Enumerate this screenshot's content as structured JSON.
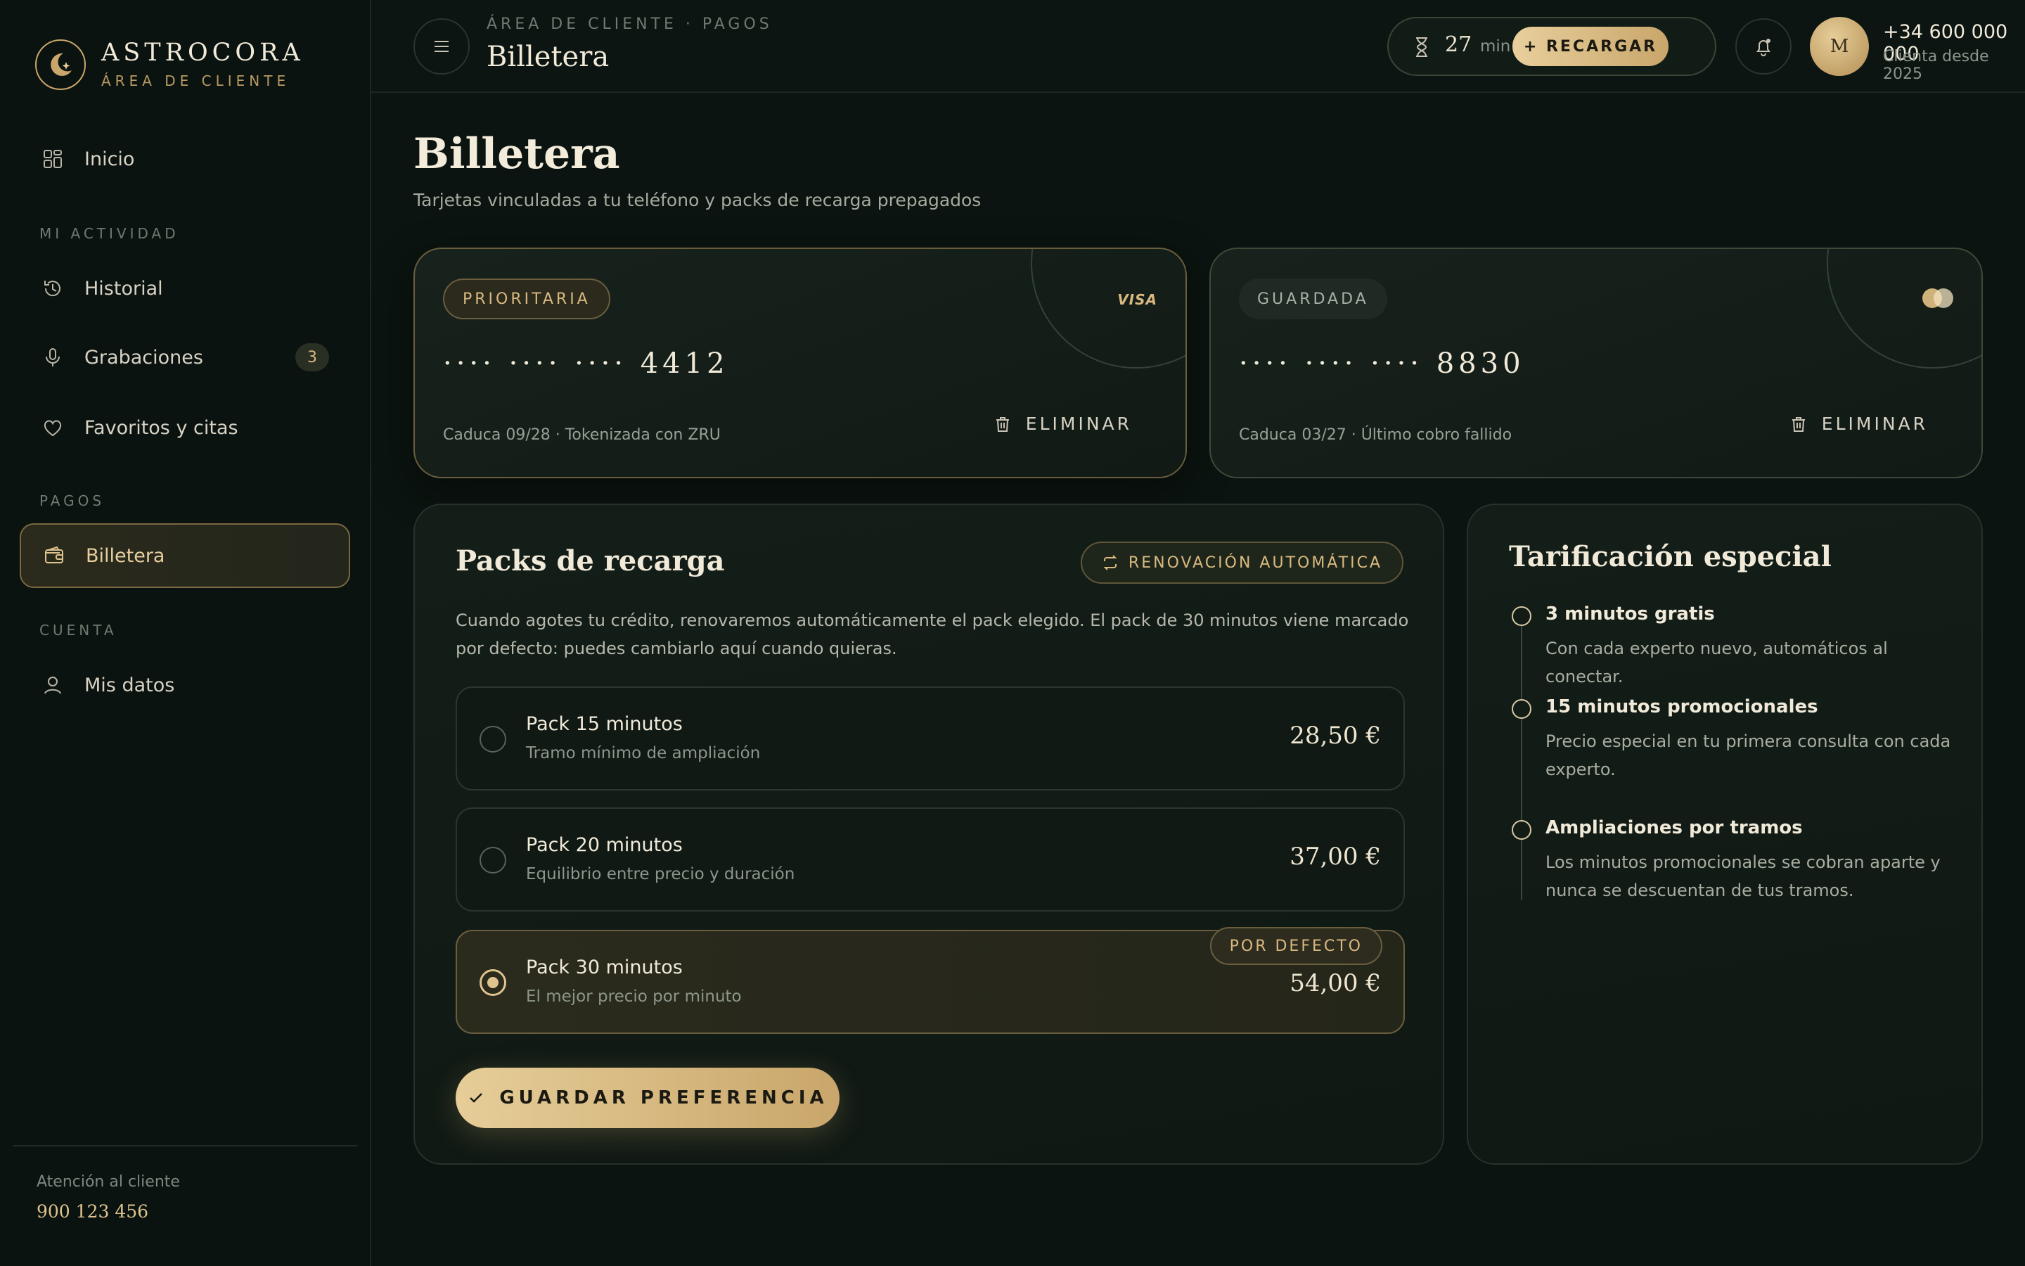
{
  "brand": {
    "name": "ASTROCORA",
    "subtitle": "ÁREA DE CLIENTE"
  },
  "sidebar": {
    "items": [
      {
        "label": "Inicio",
        "icon": "grid-icon"
      },
      {
        "label": "Historial",
        "icon": "history-icon"
      },
      {
        "label": "Grabaciones",
        "icon": "mic-icon",
        "badge": "3"
      },
      {
        "label": "Favoritos y citas",
        "icon": "heart-icon"
      },
      {
        "label": "Billetera",
        "icon": "wallet-icon",
        "active": true
      },
      {
        "label": "Mis datos",
        "icon": "user-icon"
      }
    ],
    "sections": {
      "activity": "MI ACTIVIDAD",
      "payments": "PAGOS",
      "account": "CUENTA"
    },
    "support_label": "Atención al cliente",
    "support_phone": "900 123 456"
  },
  "topbar": {
    "breadcrumb": "ÁREA DE CLIENTE · PAGOS",
    "title": "Billetera",
    "credit_value": "27",
    "credit_unit": "min",
    "recharge_label": "+ RECARGAR",
    "avatar_initial": "M",
    "user_phone": "+34 600 000 000",
    "user_since": "Clienta desde 2025"
  },
  "page": {
    "title": "Billetera",
    "subtitle": "Tarjetas vinculadas a tu teléfono y packs de recarga prepagados"
  },
  "cards": [
    {
      "tag": "PRIORITARIA",
      "brand": "VISA",
      "number": "···· ···· ···· 4412",
      "meta": "Caduca 09/28 · Tokenizada con ZRU",
      "delete_label": "ELIMINAR"
    },
    {
      "tag": "GUARDADA",
      "brand": "mastercard-icon",
      "number": "···· ···· ···· 8830",
      "meta": "Caduca 03/27 · Último cobro fallido",
      "delete_label": "ELIMINAR"
    }
  ],
  "packs": {
    "title": "Packs de recarga",
    "auto_label": "RENOVACIÓN AUTOMÁTICA",
    "description": "Cuando agotes tu crédito, renovaremos automáticamente el pack elegido. El pack de 30 minutos viene marcado por defecto: puedes cambiarlo aquí cuando quieras.",
    "items": [
      {
        "name": "Pack 15 minutos",
        "sub": "Tramo mínimo de ampliación",
        "price": "28,50 €"
      },
      {
        "name": "Pack 20 minutos",
        "sub": "Equilibrio entre precio y duración",
        "price": "37,00 €"
      },
      {
        "name": "Pack 30 minutos",
        "sub": "El mejor precio por minuto",
        "price": "54,00 €",
        "badge": "POR DEFECTO",
        "selected": true
      }
    ],
    "save_label": "GUARDAR PREFERENCIA"
  },
  "special": {
    "title": "Tarificación especial",
    "items": [
      {
        "title": "3 minutos gratis",
        "text": "Con cada experto nuevo, automáticos al conectar."
      },
      {
        "title": "15 minutos promocionales",
        "text": "Precio especial en tu primera consulta con cada experto."
      },
      {
        "title": "Ampliaciones por tramos",
        "text": "Los minutos promocionales se cobran aparte y nunca se descuentan de tus tramos."
      }
    ]
  },
  "colors": {
    "accent": "#d9b97f",
    "background": "#0b1410",
    "panel": "#141e18"
  }
}
